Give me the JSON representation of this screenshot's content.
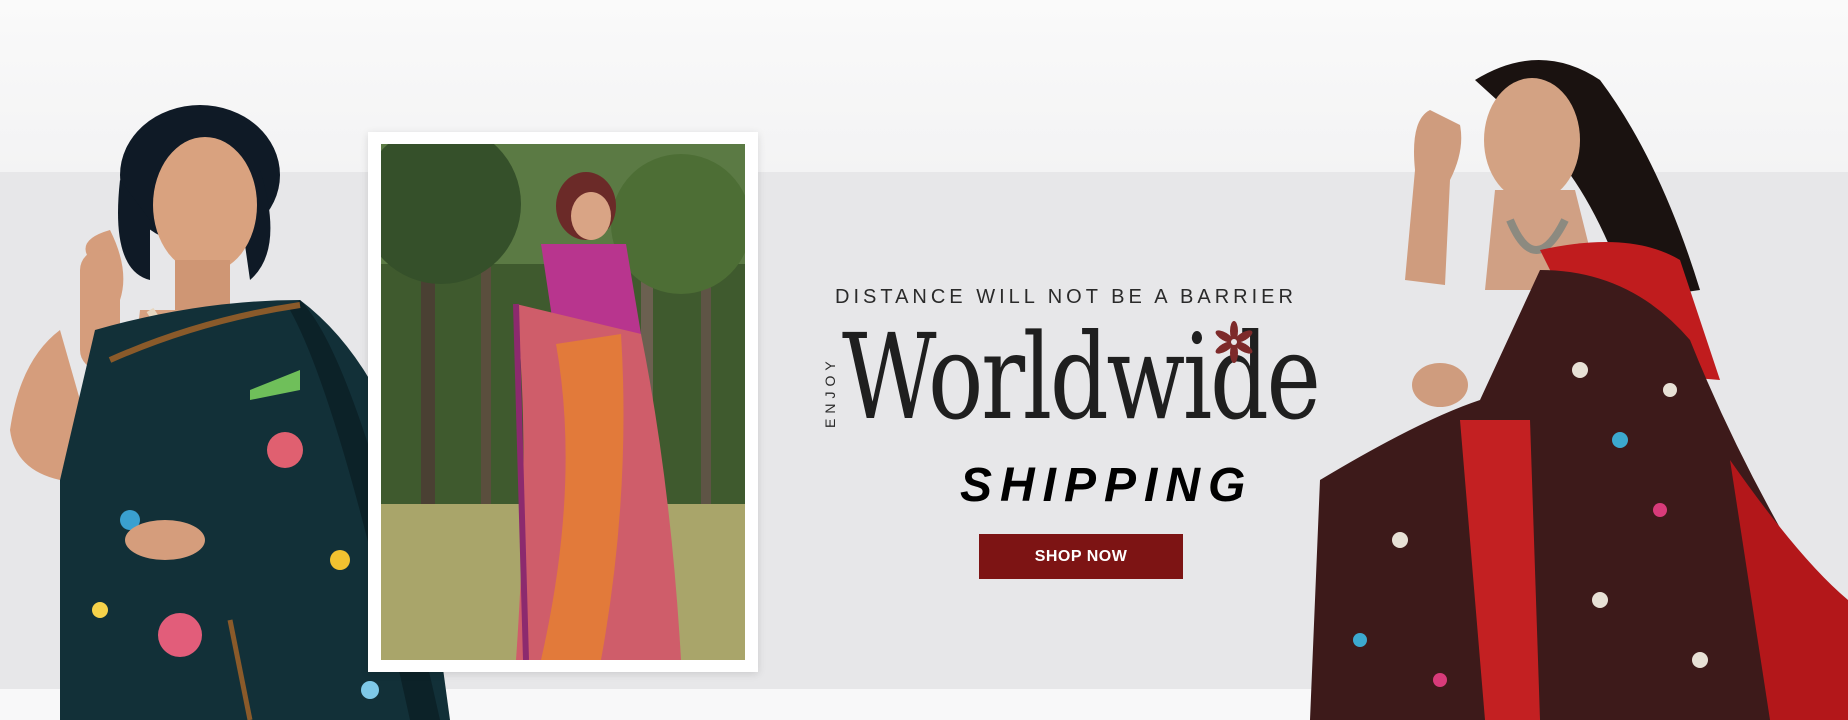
{
  "banner": {
    "tagline": "DISTANCE WILL NOT BE A BARRIER",
    "side_word": "ENJOY",
    "headline": "Worldwide",
    "subheadline": "SHIPPING",
    "cta_label": "SHOP NOW",
    "colors": {
      "cta_background": "#7d1414",
      "flower_accent": "#7d2a2a",
      "band": "#e7e7e9"
    },
    "icons": [
      "flower-icon"
    ]
  }
}
